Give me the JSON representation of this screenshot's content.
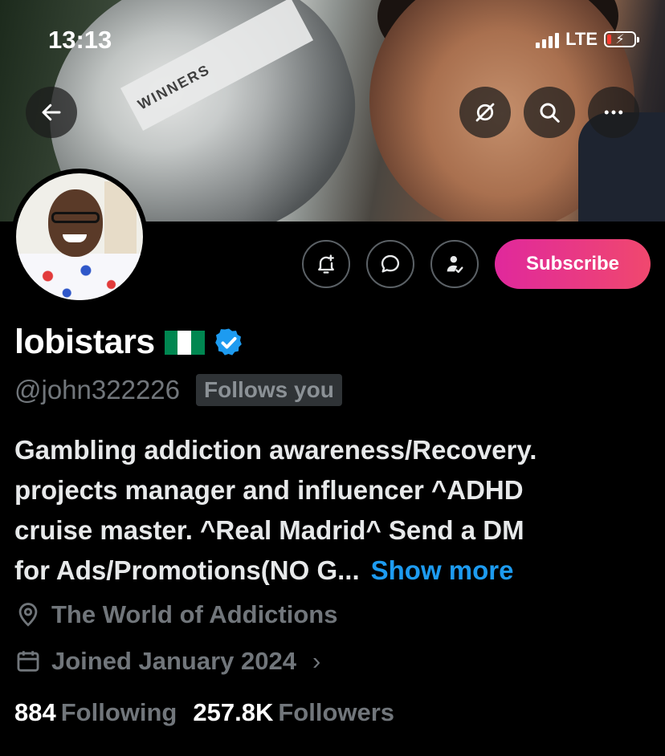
{
  "status_bar": {
    "time": "13:13",
    "network": "LTE"
  },
  "banner": {
    "ribbon_text": "WINNERS",
    "buttons": {
      "back_icon": "back-arrow-icon",
      "grok_icon": "grok-icon",
      "search_icon": "search-icon",
      "more_icon": "more-icon"
    }
  },
  "actions": {
    "notify_icon": "bell-plus-icon",
    "message_icon": "message-icon",
    "follow_icon": "person-check-icon",
    "subscribe_label": "Subscribe"
  },
  "profile": {
    "name": "lobistars",
    "flag_colors": [
      "#008751",
      "#ffffff",
      "#008751"
    ],
    "verified": true,
    "handle": "@john322226",
    "follows_you_label": "Follows you",
    "bio_lines": [
      "Gambling addiction awareness/Recovery.",
      "projects manager and influencer ^ADHD",
      "cruise master. ^Real Madrid^ Send a DM",
      "for Ads/Promotions(NO G..."
    ],
    "show_more_label": "Show more",
    "location": "The World of Addictions",
    "joined": "Joined January 2024",
    "following_count": "884",
    "following_label": "Following",
    "followers_count": "257.8K",
    "followers_label": "Followers"
  },
  "colors": {
    "accent_blue": "#1d9bf0",
    "subscribe_start": "#e0289c",
    "subscribe_end": "#f0486e",
    "muted_text": "#71767b"
  }
}
